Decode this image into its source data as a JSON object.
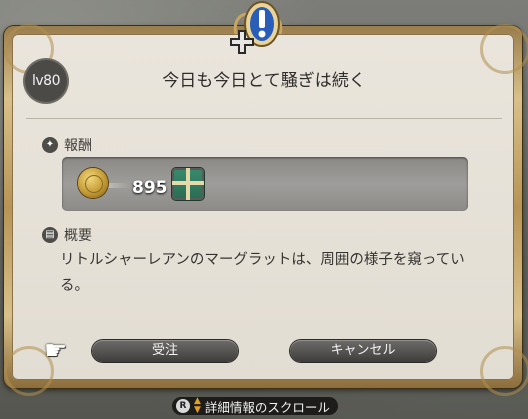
{
  "quest": {
    "level": "lv80",
    "title": "今日も今日とて騒ぎは続く"
  },
  "rewards": {
    "label": "報酬",
    "gil_amount": "895",
    "item_icon": "gift-box-icon",
    "currency_icon": "gil-coin-icon"
  },
  "summary": {
    "label": "概要",
    "text": "リトルシャーレアンのマーグラットは、周囲の様子を窺っている。"
  },
  "buttons": {
    "accept": "受注",
    "cancel": "キャンセル"
  },
  "footer": {
    "key": "R",
    "hint": "詳細情報のスクロール"
  },
  "colors": {
    "frame_gold": "#b79455",
    "panel_bg": "#e6e1d8",
    "button_dark": "#4a4946",
    "quest_icon_blue": "#2a5db8"
  }
}
